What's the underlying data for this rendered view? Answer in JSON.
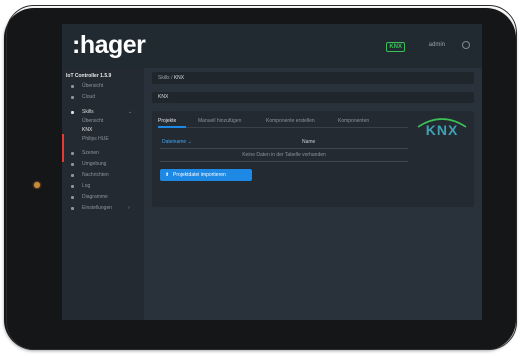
{
  "app": {
    "logo": ":hager",
    "version": "IoT Controller 1.5.9"
  },
  "topbar": {
    "knx_badge": "KNX",
    "user": "admin"
  },
  "sidebar": {
    "items": [
      {
        "label": "Übersicht"
      },
      {
        "label": "Cloud"
      },
      {
        "label": "Skills",
        "caret": "⌄"
      },
      {
        "label": "Übersicht"
      },
      {
        "label": "KNX"
      },
      {
        "label": "Philips HUE"
      },
      {
        "label": "Szenen"
      },
      {
        "label": "Umgebung"
      },
      {
        "label": "Nachrichten"
      },
      {
        "label": "Log"
      },
      {
        "label": "Diagramme"
      },
      {
        "label": "Einstellungen",
        "caret": "›"
      }
    ]
  },
  "breadcrumb": {
    "parent": "Skills",
    "sep": "/",
    "current": "KNX"
  },
  "page": {
    "title": "KNX"
  },
  "tabs": [
    "Projekte",
    "Manuell hinzufügen",
    "Komponente erstellen",
    "Komponenten"
  ],
  "table": {
    "headers": [
      "Dateiname ⌄",
      "Name"
    ],
    "empty_text": "Keine Daten in der Tabelle vorhanden"
  },
  "import_button": {
    "icon": "upload-icon",
    "label": "Projektdatei importieren"
  },
  "colors": {
    "accent": "#1e88e5",
    "active": "#e53935",
    "knx_green": "#3cbf58",
    "knx_logo": "#40a0b4"
  }
}
